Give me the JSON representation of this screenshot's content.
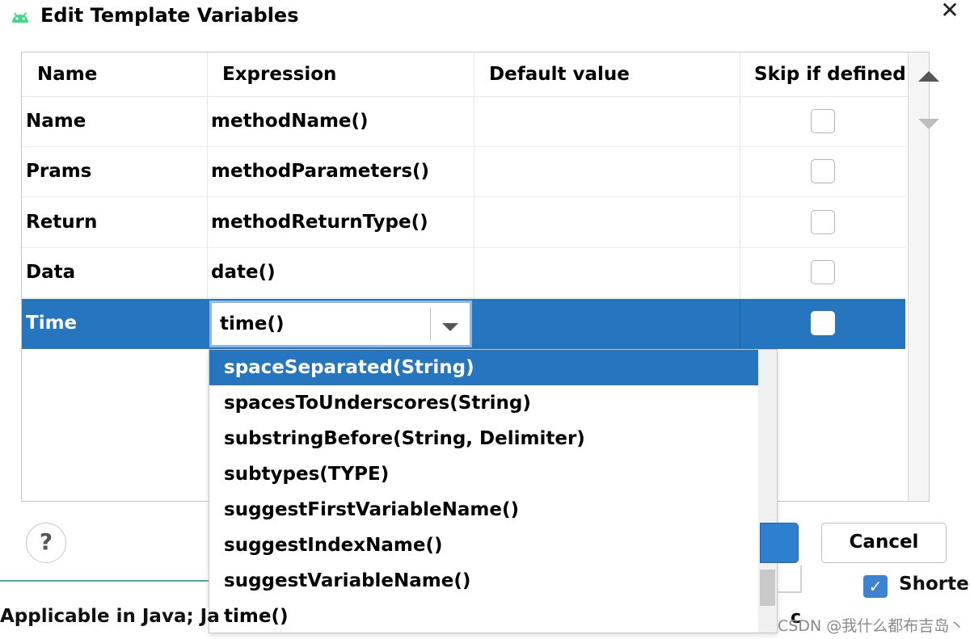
{
  "dialog": {
    "title": "Edit Template Variables",
    "close_glyph": "✕",
    "icon": "android-icon"
  },
  "table": {
    "columns": [
      "Name",
      "Expression",
      "Default value",
      "Skip if defined"
    ],
    "rows": [
      {
        "name": "Name",
        "expression": "methodName()",
        "default": "",
        "skip": false
      },
      {
        "name": "Prams",
        "expression": "methodParameters()",
        "default": "",
        "skip": false
      },
      {
        "name": "Return",
        "expression": "methodReturnType()",
        "default": "",
        "skip": false
      },
      {
        "name": "Data",
        "expression": "date()",
        "default": "",
        "skip": false
      },
      {
        "name": "Time",
        "expression": "time()",
        "default": "",
        "skip": false,
        "selected": true
      }
    ]
  },
  "autocomplete": {
    "items": [
      "spaceSeparated(String)",
      "spacesToUnderscores(String)",
      "substringBefore(String, Delimiter)",
      "subtypes(TYPE)",
      "suggestFirstVariableName()",
      "suggestIndexName()",
      "suggestVariableName()",
      "time()"
    ],
    "highlighted_index": 0
  },
  "buttons": {
    "help": "?",
    "cancel": "Cancel"
  },
  "background": {
    "applicable_text": "Applicable in Java; Ja",
    "shorten_text": "Shorten",
    "checkbox_glyph": "✓",
    "trailing_glyph": "c",
    "watermark": "CSDN @我什么都布吉岛丶"
  },
  "colors": {
    "selection": "#2675bf",
    "accent_green": "#3fb87f"
  }
}
